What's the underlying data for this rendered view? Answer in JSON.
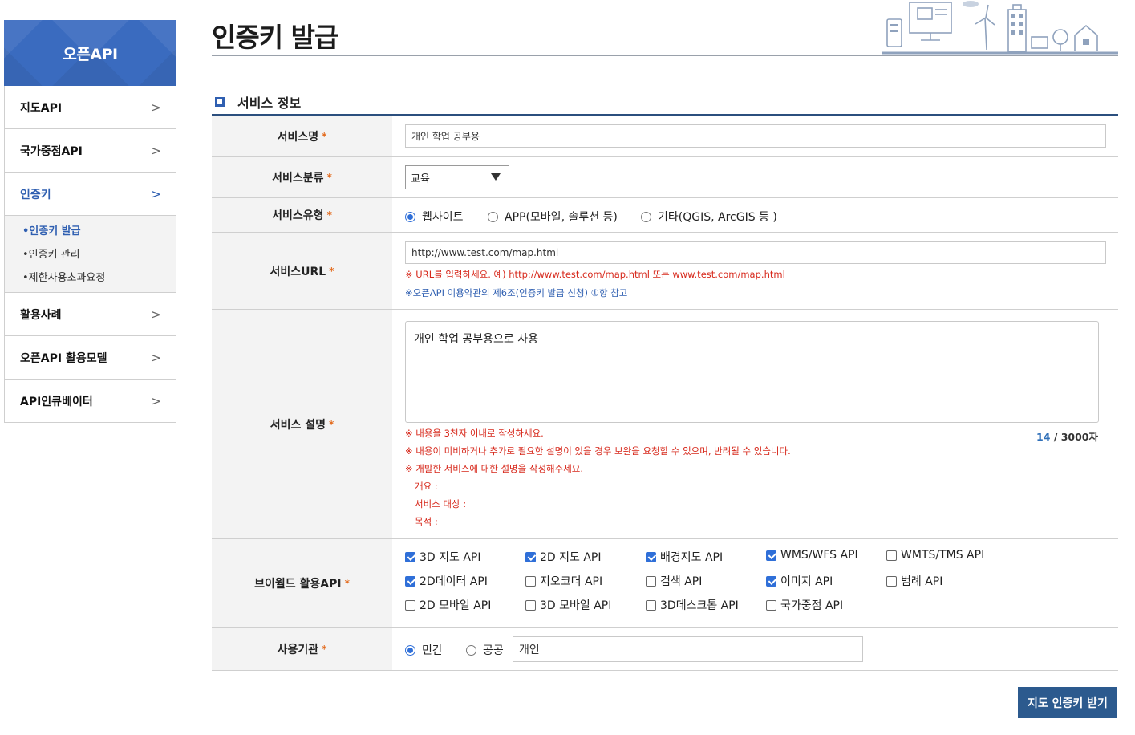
{
  "sidebar": {
    "header": "오픈API",
    "items": [
      {
        "label": "지도API"
      },
      {
        "label": "국가중점API"
      },
      {
        "label": "인증키"
      },
      {
        "label": "활용사례"
      },
      {
        "label": "오픈API 활용모델"
      },
      {
        "label": "API인큐베이터"
      }
    ],
    "sub_items": [
      {
        "label": "•인증키 발급"
      },
      {
        "label": "•인증키 관리"
      },
      {
        "label": "•제한사용초과요청"
      }
    ]
  },
  "page": {
    "title": "인증키 발급"
  },
  "section": {
    "title": "서비스 정보"
  },
  "form": {
    "service_name": {
      "label": "서비스명",
      "value": "개인 학업 공부용"
    },
    "service_category": {
      "label": "서비스분류",
      "value": "교육"
    },
    "service_type": {
      "label": "서비스유형",
      "options": [
        "웹사이트",
        "APP(모바일, 솔루션 등)",
        "기타(QGIS, ArcGIS 등 )"
      ],
      "selected": "웹사이트"
    },
    "service_url": {
      "label": "서비스URL",
      "value": "http://www.test.com/map.html",
      "note_red": "※ URL를 입력하세요. 예) http://www.test.com/map.html 또는 www.test.com/map.html",
      "note_blue": "※오픈API 이용약관의 제6조(인증키 발급 신청) ①항 참고"
    },
    "service_desc": {
      "label": "서비스 설명",
      "value": "개인 학업 공부용으로 사용",
      "count": "14",
      "count_suffix": "/ 3000자",
      "notes": [
        "※  내용을 3천자 이내로 작성하세요.",
        "※  내용이 미비하거나 추가로 필요한 설명이 있을 경우 보완을 요청할 수 있으며, 반려될 수 있습니다.",
        "※  개발한 서비스에 대한 설명을 작성해주세요.",
        "개요 :",
        "서비스 대상 :",
        "목적 :"
      ]
    },
    "apis": {
      "label": "브이월드 활용API",
      "items": [
        {
          "label": "3D 지도 API",
          "checked": true
        },
        {
          "label": "2D 지도 API",
          "checked": true
        },
        {
          "label": "배경지도 API",
          "checked": true
        },
        {
          "label": "WMS/WFS API",
          "checked": true
        },
        {
          "label": "WMTS/TMS API",
          "checked": false
        },
        {
          "label": "2D데이터 API",
          "checked": true
        },
        {
          "label": "지오코더 API",
          "checked": false
        },
        {
          "label": "검색 API",
          "checked": false
        },
        {
          "label": "이미지 API",
          "checked": true
        },
        {
          "label": "범례 API",
          "checked": false
        },
        {
          "label": "2D 모바일 API",
          "checked": false
        },
        {
          "label": "3D 모바일 API",
          "checked": false
        },
        {
          "label": "3D데스크톱 API",
          "checked": false
        },
        {
          "label": "국가중점 API",
          "checked": false
        }
      ]
    },
    "org": {
      "label": "사용기관",
      "options": [
        "민간",
        "공공"
      ],
      "selected": "민간",
      "value": "개인"
    }
  },
  "submit_label": "지도 인증키 받기",
  "colors": {
    "accent": "#2f5fb1",
    "button": "#2c5a8e",
    "required": "#e36a1c",
    "warning": "#d7281b"
  }
}
